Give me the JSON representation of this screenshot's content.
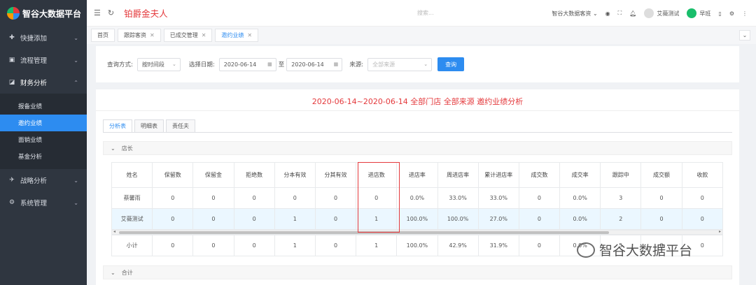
{
  "app": {
    "logo_text": "智谷大数据平台",
    "company": "铂爵金夫人"
  },
  "topbar": {
    "search_placeholder": "搜索...",
    "store_label": "智谷大数据客资",
    "user_name": "艾薇测试",
    "shift_label": "早班"
  },
  "sidebar": {
    "items": [
      {
        "label": "快捷添加",
        "icon": "plus-icon"
      },
      {
        "label": "流程管理",
        "icon": "flow-icon"
      },
      {
        "label": "财务分析",
        "icon": "finance-icon",
        "expanded": true
      },
      {
        "label": "战略分析",
        "icon": "plane-icon"
      },
      {
        "label": "系统管理",
        "icon": "gear-icon"
      }
    ],
    "sub_items": [
      "报备业绩",
      "邀约业绩",
      "面销业绩",
      "基金分析"
    ],
    "active_sub": "邀约业绩"
  },
  "tabs": [
    {
      "label": "首页"
    },
    {
      "label": "跟踪客资"
    },
    {
      "label": "已成交管理"
    },
    {
      "label": "邀约业绩"
    }
  ],
  "filter": {
    "query_mode_label": "查询方式:",
    "query_mode_value": "按时间段",
    "date_label": "选择日期:",
    "date_from": "2020-06-14",
    "to_label": "至",
    "date_to": "2020-06-14",
    "source_label": "来源:",
    "source_placeholder": "全部来源",
    "query_button": "查询"
  },
  "report": {
    "title": "2020-06-14~2020-06-14 全部门店 全部来源 邀约业绩分析",
    "subtabs": [
      "分析表",
      "明细表",
      "责任夫"
    ],
    "section_store_manager": "店长",
    "section_total": "合计"
  },
  "table": {
    "columns": [
      "姓名",
      "保留数",
      "保留金",
      "拒绝数",
      "分本有效",
      "分其有效",
      "进店数",
      "进店率",
      "周进店率",
      "累计进店率",
      "成交数",
      "成交率",
      "跟踪中",
      "成交额",
      "收款"
    ],
    "rows": [
      [
        "蔡馨雨",
        "0",
        "0",
        "0",
        "0",
        "0",
        "0",
        "0.0%",
        "33.0%",
        "33.0%",
        "0",
        "0.0%",
        "3",
        "0",
        "0"
      ],
      [
        "艾薇测试",
        "0",
        "0",
        "0",
        "1",
        "0",
        "1",
        "100.0%",
        "100.0%",
        "27.0%",
        "0",
        "0.0%",
        "2",
        "0",
        "0"
      ]
    ],
    "subtotal": [
      "小计",
      "0",
      "0",
      "0",
      "1",
      "0",
      "1",
      "100.0%",
      "42.9%",
      "31.9%",
      "0",
      "0.0%",
      "5",
      "0",
      "0"
    ]
  },
  "watermark": "智谷大数据平台"
}
